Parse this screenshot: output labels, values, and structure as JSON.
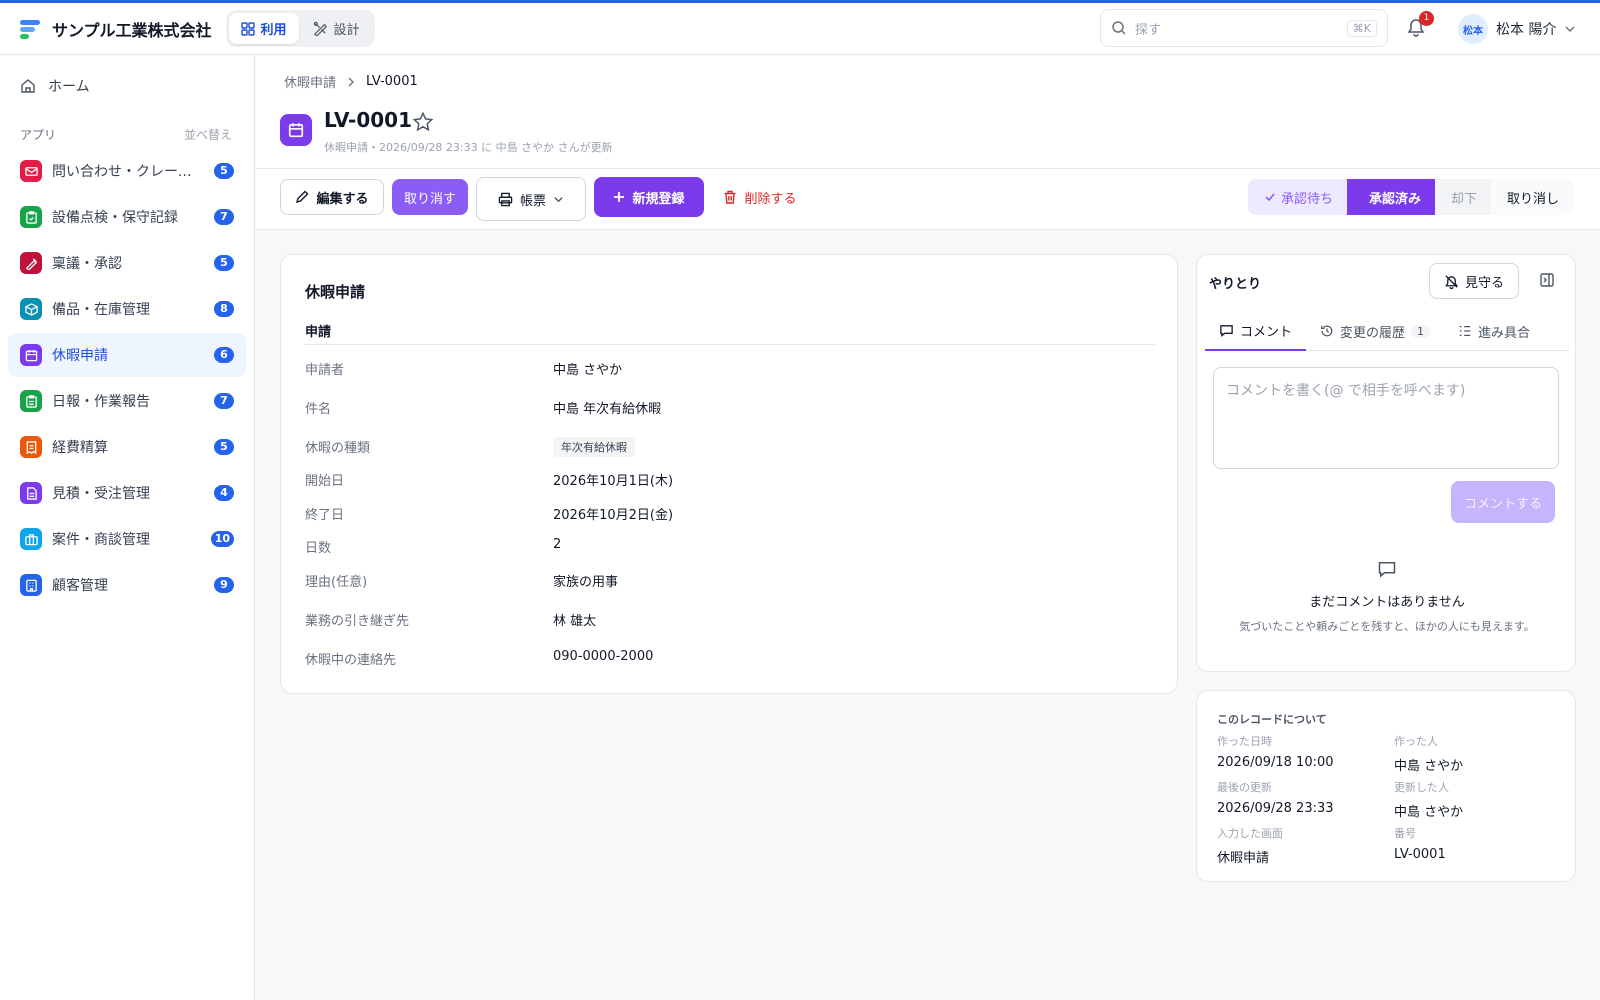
{
  "header": {
    "company": "サンプル工業株式会社",
    "modes": [
      {
        "label": "利用"
      },
      {
        "label": "設計"
      }
    ],
    "search": {
      "placeholder": "探す",
      "shortcut": "⌘K"
    },
    "notification_count": "1",
    "user": {
      "avatar": "松本",
      "name": "松本 陽介"
    }
  },
  "sidebar": {
    "home": "ホーム",
    "apps_heading": "アプリ",
    "sort_label": "並べ替え",
    "items": [
      {
        "label": "問い合わせ・クレーム管...",
        "count": "5",
        "color": "#e11d48"
      },
      {
        "label": "設備点検・保守記録",
        "count": "7",
        "color": "#16a34a"
      },
      {
        "label": "稟議・承認",
        "count": "5",
        "color": "#be123c"
      },
      {
        "label": "備品・在庫管理",
        "count": "8",
        "color": "#0891b2"
      },
      {
        "label": "休暇申請",
        "count": "6",
        "color": "#7c3aed"
      },
      {
        "label": "日報・作業報告",
        "count": "7",
        "color": "#16a34a"
      },
      {
        "label": "経費精算",
        "count": "5",
        "color": "#ea580c"
      },
      {
        "label": "見積・受注管理",
        "count": "4",
        "color": "#7c3aed"
      },
      {
        "label": "案件・商談管理",
        "count": "10",
        "color": "#0ea5e9"
      },
      {
        "label": "顧客管理",
        "count": "9",
        "color": "#2563eb"
      }
    ]
  },
  "breadcrumb": {
    "parent": "休暇申請",
    "current": "LV-0001"
  },
  "record": {
    "title": "LV-0001",
    "subtitle": "休暇申請・2026/09/28 23:33 に 中島 さやか さんが更新"
  },
  "toolbar": {
    "edit": "編集する",
    "cancel": "取り消す",
    "print": "帳票",
    "new": "新規登録",
    "delete": "削除する"
  },
  "status_steps": [
    {
      "label": "承認待ち",
      "state": "done"
    },
    {
      "label": "承認済み",
      "state": "current"
    },
    {
      "label": "却下",
      "state": "pending"
    },
    {
      "label": "取り消し",
      "state": "pending"
    }
  ],
  "form": {
    "title": "休暇申請",
    "section": "申請",
    "fields": [
      {
        "label": "申請者",
        "value": "中島 さやか"
      },
      {
        "label": "件名",
        "value": "中島 年次有給休暇"
      },
      {
        "label": "休暇の種類",
        "value": "年次有給休暇"
      },
      {
        "label": "開始日",
        "value": "2026年10月1日(木)"
      },
      {
        "label": "終了日",
        "value": "2026年10月2日(金)"
      },
      {
        "label": "日数",
        "value": "2"
      },
      {
        "label": "理由(任意)",
        "value": "家族の用事"
      },
      {
        "label": "業務の引き継ぎ先",
        "value": "林 雄太"
      },
      {
        "label": "休暇中の連絡先",
        "value": "090-0000-2000"
      }
    ]
  },
  "discussion": {
    "title": "やりとり",
    "watch": "見守る",
    "tabs": [
      {
        "label": "コメント"
      },
      {
        "label": "変更の履歴",
        "count": "1"
      },
      {
        "label": "進み具合"
      }
    ],
    "comment_placeholder": "コメントを書く(@ で相手を呼べます)",
    "submit": "コメントする",
    "empty_title": "まだコメントはありません",
    "empty_desc": "気づいたことや頼みごとを残すと、ほかの人にも見えます。"
  },
  "record_info": {
    "title": "このレコードについて",
    "items": [
      {
        "label": "作った日時",
        "value": "2026/09/18 10:00"
      },
      {
        "label": "作った人",
        "value": "中島 さやか"
      },
      {
        "label": "最後の更新",
        "value": "2026/09/28 23:33"
      },
      {
        "label": "更新した人",
        "value": "中島 さやか"
      },
      {
        "label": "入力した画面",
        "value": "休暇申請"
      },
      {
        "label": "番号",
        "value": "LV-0001"
      }
    ]
  },
  "colors": {
    "accent": "#7c3aed",
    "primary": "#2563eb",
    "danger": "#dc2626"
  }
}
